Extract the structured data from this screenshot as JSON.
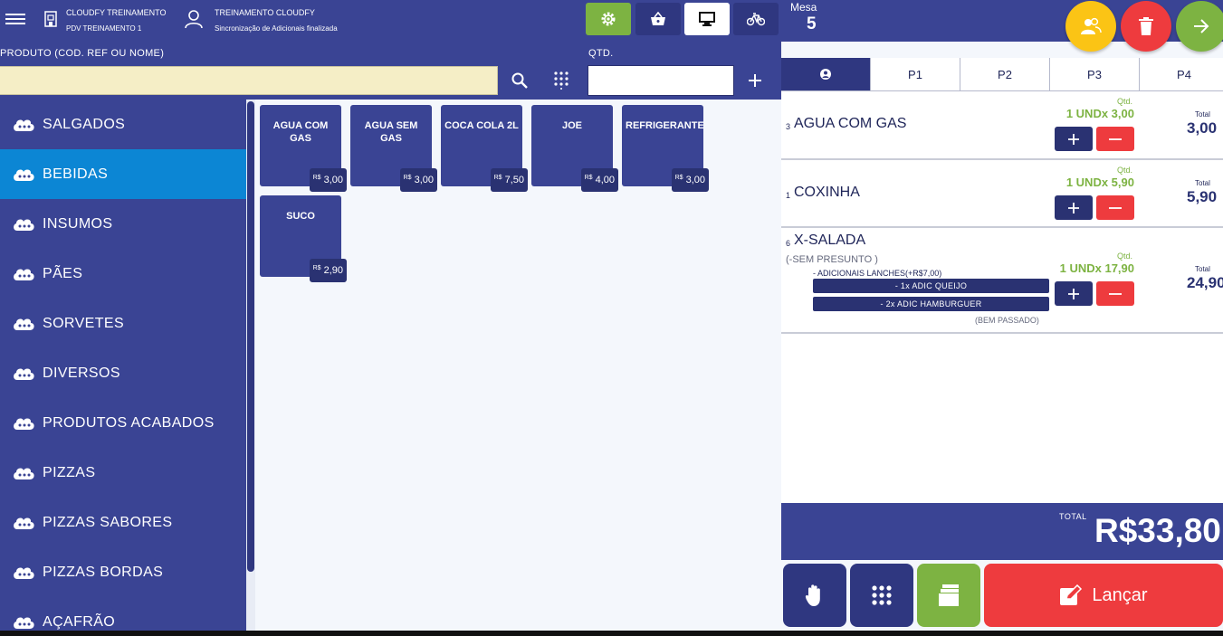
{
  "header": {
    "company_name": "CLOUDFY TREINAMENTO",
    "pdv_name": "PDV TREINAMENTO 1",
    "user_name": "TREINAMENTO CLOUDFY",
    "sync_status": "Sincronização de Adicionais finalizada",
    "icons": [
      "menu-icon",
      "store-icon",
      "user-icon",
      "settings-icon",
      "basket-icon",
      "desktop-icon",
      "bike-icon"
    ]
  },
  "search": {
    "label": "PRODUTO (COD. REF OU NOME)",
    "value": "",
    "qty_label": "QTD.",
    "qty_value": ""
  },
  "categories": [
    {
      "label": "SALGADOS",
      "active": false
    },
    {
      "label": "BEBIDAS",
      "active": true
    },
    {
      "label": "INSUMOS",
      "active": false
    },
    {
      "label": "PÃES",
      "active": false
    },
    {
      "label": "SORVETES",
      "active": false
    },
    {
      "label": "DIVERSOS",
      "active": false
    },
    {
      "label": "PRODUTOS ACABADOS",
      "active": false
    },
    {
      "label": "PIZZAS",
      "active": false
    },
    {
      "label": "PIZZAS SABORES",
      "active": false
    },
    {
      "label": "PIZZAS BORDAS",
      "active": false
    },
    {
      "label": "AÇAFRÃO",
      "active": false
    }
  ],
  "products": [
    {
      "name": "AGUA COM GAS",
      "currency": "R$",
      "price": "3,00"
    },
    {
      "name": "AGUA SEM GAS",
      "currency": "R$",
      "price": "3,00"
    },
    {
      "name": "COCA COLA 2L",
      "currency": "R$",
      "price": "7,50"
    },
    {
      "name": "JOE",
      "currency": "R$",
      "price": "4,00"
    },
    {
      "name": "REFRIGERANTE",
      "currency": "R$",
      "price": "3,00"
    },
    {
      "name": "SUCO",
      "currency": "R$",
      "price": "2,90"
    }
  ],
  "order": {
    "mesa_label": "Mesa",
    "mesa_number": "5",
    "tabs": [
      {
        "label": "",
        "icon": "person-icon",
        "active": true
      },
      {
        "label": "P1",
        "active": false
      },
      {
        "label": "P2",
        "active": false
      },
      {
        "label": "P3",
        "active": false
      },
      {
        "label": "P4",
        "active": false
      }
    ],
    "items": [
      {
        "index": "3",
        "name": "AGUA COM GAS",
        "qtd_label": "Qtd.",
        "qty": "1 UND",
        "unit_price": "x 3,00",
        "total_label": "Total",
        "total": "3,00"
      },
      {
        "index": "1",
        "name": "COXINHA",
        "qtd_label": "Qtd.",
        "qty": "1 UND",
        "unit_price": "x 5,90",
        "total_label": "Total",
        "total": "5,90"
      },
      {
        "index": "6",
        "name": "X-SALADA",
        "subtitle": "(-SEM PRESUNTO )",
        "addon_title": "- ADICIONAIS LANCHES(+R$7,00)",
        "addons": [
          "- 1x ADIC QUEIJO",
          "- 2x ADIC HAMBURGUER"
        ],
        "note": "(BEM PASSADO)",
        "qtd_label": "Qtd.",
        "qty": "1 UND",
        "unit_price": "x 17,90",
        "total_label": "Total",
        "total": "24,90"
      }
    ],
    "total_label": "TOTAL",
    "total_value": "R$33,80",
    "launch_label": "Lançar"
  },
  "colors": {
    "primary": "#3a4494",
    "dark": "#2a3272",
    "active_category": "#0c86d4",
    "green": "#7db342",
    "red": "#ee3b3e",
    "yellow": "#fbc415",
    "search_bg": "#f5eec6"
  }
}
